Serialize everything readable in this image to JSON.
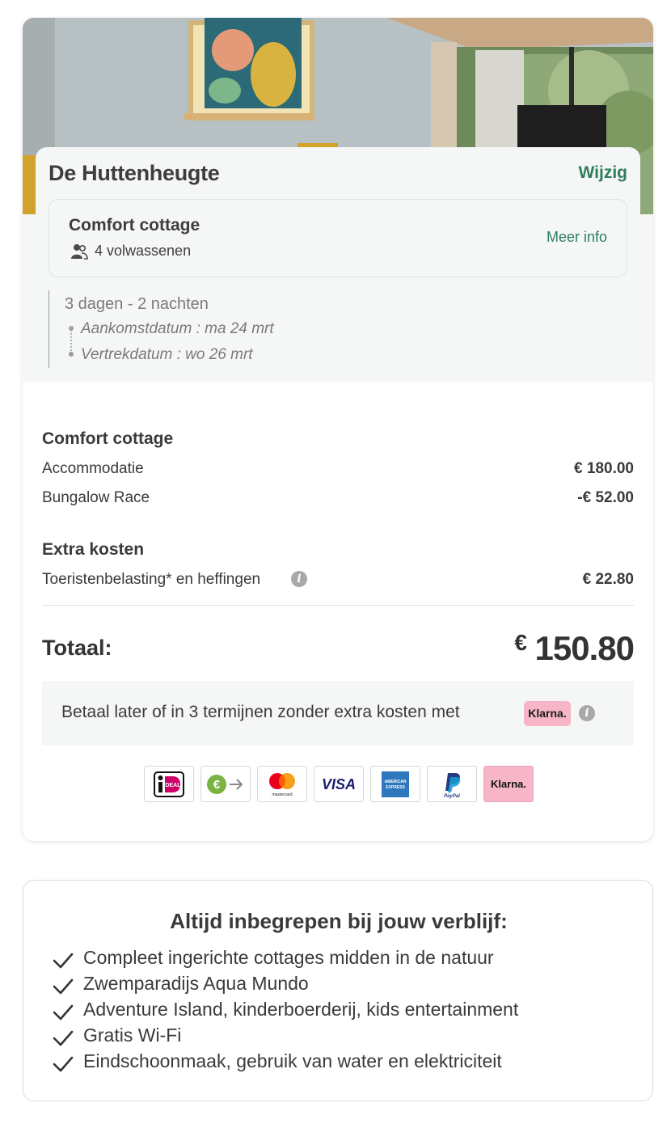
{
  "booking": {
    "park_name": "De Huttenheugte",
    "change_link": "Wijzig",
    "accommodation": {
      "name": "Comfort cottage",
      "guests": "4 volwassenen",
      "more_info": "Meer info"
    },
    "stay": {
      "duration": "3 dagen - 2 nachten",
      "arrival": "Aankomstdatum : ma 24 mrt",
      "departure": "Vertrekdatum : wo 26 mrt"
    }
  },
  "price": {
    "section1_title": "Comfort cottage",
    "lines1": [
      {
        "label": "Accommodatie",
        "value": "€ 180.00"
      },
      {
        "label": "Bungalow Race",
        "value": "-€ 52.00"
      }
    ],
    "section2_title": "Extra kosten",
    "lines2": [
      {
        "label": "Toeristenbelasting* en heffingen",
        "value": "€ 22.80"
      }
    ],
    "total_label": "Totaal:",
    "total_currency": "€",
    "total_value": "150.80"
  },
  "klarna": {
    "text": "Betaal later of in 3 termijnen zonder extra kosten met",
    "badge": "Klarna."
  },
  "payment_methods": [
    {
      "name": "iDEAL",
      "label": "iDEAL"
    },
    {
      "name": "bank-transfer",
      "label": "€"
    },
    {
      "name": "mastercard",
      "label": "mastercard"
    },
    {
      "name": "visa",
      "label": "VISA"
    },
    {
      "name": "american-express",
      "label": "AMERICAN EXPRESS"
    },
    {
      "name": "paypal",
      "label": "PayPal"
    },
    {
      "name": "klarna",
      "label": "Klarna."
    }
  ],
  "included": {
    "title": "Altijd inbegrepen bij jouw verblijf:",
    "items": [
      "Compleet ingerichte cottages midden in de natuur",
      "Zwemparadijs Aqua Mundo",
      "Adventure Island, kinderboerderij, kids entertainment",
      "Gratis Wi-Fi",
      "Eindschoonmaak, gebruik van water en elektriciteit"
    ]
  },
  "colors": {
    "accent_green": "#2f7d5d",
    "panel_bg": "#f5f7f6",
    "klarna_pink": "#f6b6c8"
  }
}
